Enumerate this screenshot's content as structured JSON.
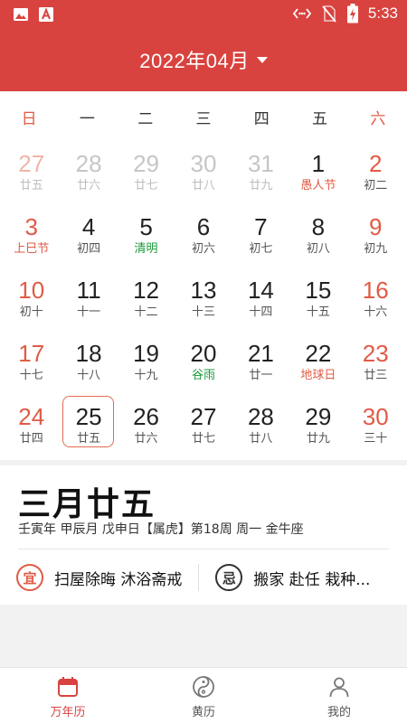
{
  "status_bar": {
    "time": "5:33"
  },
  "header": {
    "month_label": "2022年04月"
  },
  "weekdays": [
    "日",
    "一",
    "二",
    "三",
    "四",
    "五",
    "六"
  ],
  "calendar": {
    "rows": [
      [
        {
          "day": "27",
          "sub": "廿五",
          "other": true
        },
        {
          "day": "28",
          "sub": "廿六",
          "other": true
        },
        {
          "day": "29",
          "sub": "廿七",
          "other": true
        },
        {
          "day": "30",
          "sub": "廿八",
          "other": true
        },
        {
          "day": "31",
          "sub": "廿九",
          "other": true
        },
        {
          "day": "1",
          "sub": "愚人节",
          "festival": "red"
        },
        {
          "day": "2",
          "sub": "初二"
        }
      ],
      [
        {
          "day": "3",
          "sub": "上巳节",
          "festival": "red"
        },
        {
          "day": "4",
          "sub": "初四"
        },
        {
          "day": "5",
          "sub": "清明",
          "festival": "green"
        },
        {
          "day": "6",
          "sub": "初六"
        },
        {
          "day": "7",
          "sub": "初七"
        },
        {
          "day": "8",
          "sub": "初八"
        },
        {
          "day": "9",
          "sub": "初九"
        }
      ],
      [
        {
          "day": "10",
          "sub": "初十"
        },
        {
          "day": "11",
          "sub": "十一"
        },
        {
          "day": "12",
          "sub": "十二"
        },
        {
          "day": "13",
          "sub": "十三"
        },
        {
          "day": "14",
          "sub": "十四"
        },
        {
          "day": "15",
          "sub": "十五"
        },
        {
          "day": "16",
          "sub": "十六"
        }
      ],
      [
        {
          "day": "17",
          "sub": "十七"
        },
        {
          "day": "18",
          "sub": "十八"
        },
        {
          "day": "19",
          "sub": "十九"
        },
        {
          "day": "20",
          "sub": "谷雨",
          "festival": "green"
        },
        {
          "day": "21",
          "sub": "廿一"
        },
        {
          "day": "22",
          "sub": "地球日",
          "festival": "red"
        },
        {
          "day": "23",
          "sub": "廿三"
        }
      ],
      [
        {
          "day": "24",
          "sub": "廿四"
        },
        {
          "day": "25",
          "sub": "廿五",
          "selected": true
        },
        {
          "day": "26",
          "sub": "廿六"
        },
        {
          "day": "27",
          "sub": "廿七"
        },
        {
          "day": "28",
          "sub": "廿八"
        },
        {
          "day": "29",
          "sub": "廿九"
        },
        {
          "day": "30",
          "sub": "三十"
        }
      ]
    ]
  },
  "info": {
    "lunar_date": "三月廿五",
    "detail": "壬寅年 甲辰月 戊申日【属虎】第18周 周一 金牛座",
    "yi_badge": "宜",
    "yi_text": "扫屋除晦 沐浴斋戒",
    "ji_badge": "忌",
    "ji_text": "搬家 赴任 栽种..."
  },
  "bottom_nav": [
    {
      "label": "万年历",
      "icon": "calendar-icon",
      "active": true
    },
    {
      "label": "黄历",
      "icon": "yin-yang-icon",
      "active": false
    },
    {
      "label": "我的",
      "icon": "user-icon",
      "active": false
    }
  ],
  "colors": {
    "primary": "#d8433f",
    "weekend": "#e05b45",
    "solar_term": "#1d9a3c"
  }
}
